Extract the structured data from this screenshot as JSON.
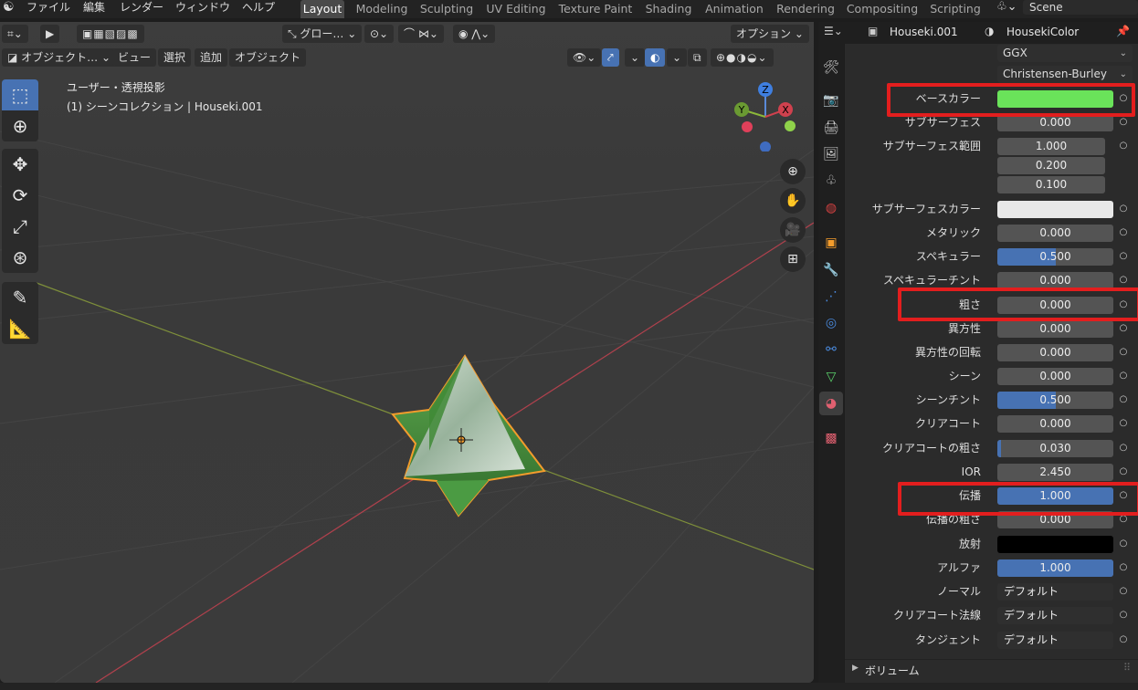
{
  "menu": {
    "logo": "blender-logo-icon",
    "items": [
      "ファイル",
      "編集",
      "レンダー",
      "ウィンドウ",
      "ヘルプ"
    ]
  },
  "workspaces": [
    "Layout",
    "Modeling",
    "Sculpting",
    "UV Editing",
    "Texture Paint",
    "Shading",
    "Animation",
    "Rendering",
    "Compositing",
    "Scripting"
  ],
  "active_workspace": "Layout",
  "scene": {
    "label": "Scene"
  },
  "viewport": {
    "header": {
      "transform_orientation": "グロー…",
      "options_label": "オプション"
    },
    "menus": [
      "オブジェクト…",
      "ビュー",
      "選択",
      "追加",
      "オブジェクト"
    ],
    "view_info": "ユーザー・透視投影",
    "collection_info": "(1) シーンコレクション | Houseki.001",
    "gizmo_axes": {
      "z": "Z",
      "y": "Y",
      "x": "X"
    }
  },
  "properties": {
    "object_name": "Houseki.001",
    "material_name": "HousekiColor",
    "distribution": "GGX",
    "subsurface_method": "Christensen-Burley",
    "rows": [
      {
        "label": "ベースカラー",
        "type": "color",
        "color": "#6ae35a"
      },
      {
        "label": "サブサーフェス",
        "type": "value",
        "value": "0.000",
        "fill": 0
      },
      {
        "label": "サブサーフェス範囲",
        "type": "vector",
        "values": [
          "1.000",
          "0.200",
          "0.100"
        ]
      },
      {
        "label": "サブサーフェスカラー",
        "type": "color",
        "color": "#e8e8e8"
      },
      {
        "label": "メタリック",
        "type": "value",
        "value": "0.000",
        "fill": 0
      },
      {
        "label": "スペキュラー",
        "type": "value",
        "value": "0.500",
        "fill": 0.5
      },
      {
        "label": "スペキュラーチント",
        "type": "value",
        "value": "0.000",
        "fill": 0
      },
      {
        "label": "粗さ",
        "type": "value",
        "value": "0.000",
        "fill": 0
      },
      {
        "label": "異方性",
        "type": "value",
        "value": "0.000",
        "fill": 0
      },
      {
        "label": "異方性の回転",
        "type": "value",
        "value": "0.000",
        "fill": 0
      },
      {
        "label": "シーン",
        "type": "value",
        "value": "0.000",
        "fill": 0
      },
      {
        "label": "シーンチント",
        "type": "value",
        "value": "0.500",
        "fill": 0.5
      },
      {
        "label": "クリアコート",
        "type": "value",
        "value": "0.000",
        "fill": 0
      },
      {
        "label": "クリアコートの粗さ",
        "type": "value",
        "value": "0.030",
        "fill": 0.03
      },
      {
        "label": "IOR",
        "type": "value",
        "value": "2.450",
        "fill": 0
      },
      {
        "label": "伝播",
        "type": "value",
        "value": "1.000",
        "fill": 1
      },
      {
        "label": "伝播の粗さ",
        "type": "value",
        "value": "0.000",
        "fill": 0
      },
      {
        "label": "放射",
        "type": "color",
        "color": "#000000"
      },
      {
        "label": "アルファ",
        "type": "value",
        "value": "1.000",
        "fill": 1
      },
      {
        "label": "ノーマル",
        "type": "text",
        "value": "デフォルト"
      },
      {
        "label": "クリアコート法線",
        "type": "text",
        "value": "デフォルト"
      },
      {
        "label": "タンジェント",
        "type": "text",
        "value": "デフォルト"
      }
    ],
    "volume_section": "ボリューム"
  }
}
